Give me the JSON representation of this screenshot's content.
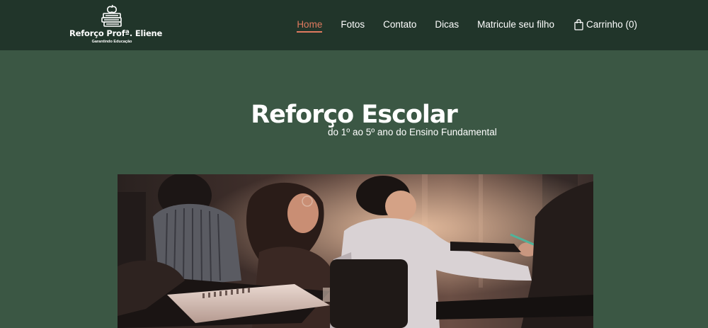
{
  "brand": {
    "name": "Reforço Profª. Eliene",
    "tagline": "Garantindo Educação",
    "logo_icon": "books-apple-icon"
  },
  "nav": {
    "items": [
      {
        "label": "Home",
        "active": true
      },
      {
        "label": "Fotos",
        "active": false
      },
      {
        "label": "Contato",
        "active": false
      },
      {
        "label": "Dicas",
        "active": false
      },
      {
        "label": "Matricule seu filho",
        "active": false
      }
    ],
    "cart_label": "Carrinho (0)",
    "cart_icon": "shopping-bag-icon"
  },
  "hero": {
    "title": "Reforço Escolar",
    "subtitle": "do 1º ao 5º ano do Ensino Fundamental"
  },
  "colors": {
    "header_bg": "#21352a",
    "page_bg": "#3b5744",
    "accent": "#e07a5f",
    "text": "#ffffff"
  }
}
